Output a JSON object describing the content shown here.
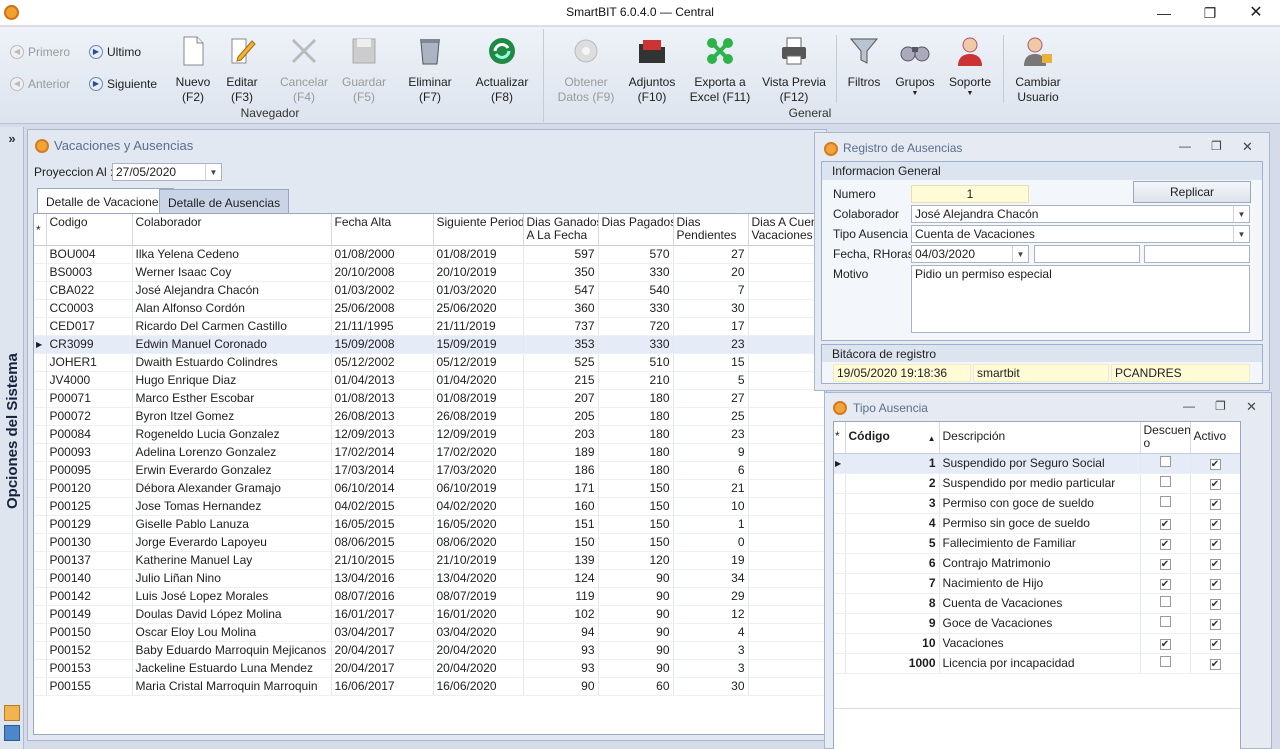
{
  "window": {
    "title": "SmartBIT 6.0.4.0 — Central",
    "minimize_icon": "minimize-icon",
    "maximize_icon": "restore-icon",
    "close_icon": "close-icon"
  },
  "navigator": {
    "first": "Primero",
    "last": "Ultimo",
    "previous": "Anterior",
    "next": "Siguiente",
    "group_label": "Navegador"
  },
  "toolbar": {
    "new": "Nuevo\n(F2)",
    "edit": "Editar\n(F3)",
    "cancel": "Cancelar\n(F4)",
    "save": "Guardar\n(F5)",
    "delete": "Eliminar\n(F7)",
    "refresh": "Actualizar\n(F8)",
    "get_data": "Obtener\nDatos (F9)",
    "attachments": "Adjuntos\n(F10)",
    "export_excel": "Exporta a\nExcel (F11)",
    "preview": "Vista Previa\n(F12)",
    "filters": "Filtros",
    "groups": "Grupos",
    "support": "Soporte",
    "change_user": "Cambiar\nUsuario",
    "general_label": "General"
  },
  "sidebar": {
    "label": "Opciones del Sistema",
    "expand": "»"
  },
  "vacations": {
    "title": "Vacaciones y Ausencias",
    "projection_label": "Proyeccion Al :",
    "projection_value": "27/05/2020",
    "tabs": [
      "Detalle de Vacaciones",
      "Detalle de Ausencias"
    ],
    "columns": [
      "Codigo",
      "Colaborador",
      "Fecha Alta",
      "Siguiente Periodo",
      "Dias Ganados\nA La Fecha",
      "Dias Pagados",
      "Dias\nPendientes",
      "Dias A Cuenta\nVacaciones"
    ],
    "rows": [
      [
        "BOU004",
        "Ilka Yelena Cedeno",
        "01/08/2000",
        "01/08/2019",
        "597",
        "570",
        "27",
        ""
      ],
      [
        "BS0003",
        "Werner Isaac Coy",
        "20/10/2008",
        "20/10/2019",
        "350",
        "330",
        "20",
        ""
      ],
      [
        "CBA022",
        "José Alejandra Chacón",
        "01/03/2002",
        "01/03/2020",
        "547",
        "540",
        "7",
        ""
      ],
      [
        "CC0003",
        "Alan Alfonso Cordón",
        "25/06/2008",
        "25/06/2020",
        "360",
        "330",
        "30",
        ""
      ],
      [
        "CED017",
        "Ricardo Del Carmen Castillo",
        "21/11/1995",
        "21/11/2019",
        "737",
        "720",
        "17",
        ""
      ],
      [
        "CR3099",
        "Edwin Manuel Coronado",
        "15/09/2008",
        "15/09/2019",
        "353",
        "330",
        "23",
        ""
      ],
      [
        "JOHER1",
        "Dwaith Estuardo Colindres",
        "05/12/2002",
        "05/12/2019",
        "525",
        "510",
        "15",
        ""
      ],
      [
        "JV4000",
        "Hugo Enrique Diaz",
        "01/04/2013",
        "01/04/2020",
        "215",
        "210",
        "5",
        ""
      ],
      [
        "P00071",
        "Marco Esther Escobar",
        "01/08/2013",
        "01/08/2019",
        "207",
        "180",
        "27",
        "3"
      ],
      [
        "P00072",
        "Byron Itzel Gomez",
        "26/08/2013",
        "26/08/2019",
        "205",
        "180",
        "25",
        "3"
      ],
      [
        "P00084",
        "Rogeneldo Lucia Gonzalez",
        "12/09/2013",
        "12/09/2019",
        "203",
        "180",
        "23",
        "3"
      ],
      [
        "P00093",
        "Adelina Lorenzo Gonzalez",
        "17/02/2014",
        "17/02/2020",
        "189",
        "180",
        "9",
        "3"
      ],
      [
        "P00095",
        "Erwin Everardo Gonzalez",
        "17/03/2014",
        "17/03/2020",
        "186",
        "180",
        "6",
        "0"
      ],
      [
        "P00120",
        "Débora Alexander Gramajo",
        "06/10/2014",
        "06/10/2019",
        "171",
        "150",
        "21",
        "3"
      ],
      [
        "P00125",
        "Jose Tomas Hernandez",
        "04/02/2015",
        "04/02/2020",
        "160",
        "150",
        "10",
        "3"
      ],
      [
        "P00129",
        "Giselle Pablo Lanuza",
        "16/05/2015",
        "16/05/2020",
        "151",
        "150",
        "1",
        "0"
      ],
      [
        "P00130",
        "Jorge Everardo Lapoyeu",
        "08/06/2015",
        "08/06/2020",
        "150",
        "150",
        "0",
        "0"
      ],
      [
        "P00137",
        "Katherine Manuel Lay",
        "21/10/2015",
        "21/10/2019",
        "139",
        "120",
        "19",
        "3"
      ],
      [
        "P00140",
        "Julio Liñan Nino",
        "13/04/2016",
        "13/04/2020",
        "124",
        "90",
        "34",
        "0"
      ],
      [
        "P00142",
        "Luis José Lopez Morales",
        "08/07/2016",
        "08/07/2019",
        "119",
        "90",
        "29",
        "3"
      ],
      [
        "P00149",
        "Doulas David López Molina",
        "16/01/2017",
        "16/01/2020",
        "102",
        "90",
        "12",
        "3"
      ],
      [
        "P00150",
        "Oscar Eloy Lou Molina",
        "03/04/2017",
        "03/04/2020",
        "94",
        "90",
        "4",
        "0"
      ],
      [
        "P00152",
        "Baby Eduardo Marroquin Mejicanos",
        "20/04/2017",
        "20/04/2020",
        "93",
        "90",
        "3",
        "0"
      ],
      [
        "P00153",
        "Jackeline Estuardo Luna Mendez",
        "20/04/2017",
        "20/04/2020",
        "93",
        "90",
        "3",
        "0"
      ],
      [
        "P00155",
        "Maria Cristal Marroquin Marroquin",
        "16/06/2017",
        "16/06/2020",
        "90",
        "60",
        "30",
        "0"
      ]
    ]
  },
  "registro": {
    "title": "Registro de Ausencias",
    "section_general": "Informacion General",
    "numero_label": "Numero",
    "numero_value": "1",
    "replicar": "Replicar",
    "colaborador_label": "Colaborador",
    "colaborador_value": "José Alejandra Chacón",
    "tipo_label": "Tipo Ausencia",
    "tipo_value": "Cuenta de Vacaciones",
    "fecha_label": "Fecha, RHoras",
    "fecha_value": "04/03/2020",
    "motivo_label": "Motivo",
    "motivo_value": "Pidio un permiso especial",
    "section_bitacora": "Bitácora de registro",
    "bitacora_fecha": "19/05/2020 19:18:36",
    "bitacora_usuario": "smartbit",
    "bitacora_equipo": "PCANDRES"
  },
  "tipo_ausencia": {
    "title": "Tipo Ausencia",
    "columns": [
      "Código",
      "Descripción",
      "Descuent\no",
      "Activo"
    ],
    "rows": [
      {
        "codigo": "1",
        "descripcion": "Suspendido por Seguro Social",
        "descuento": false,
        "activo": true
      },
      {
        "codigo": "2",
        "descripcion": "Suspendido por medio particular",
        "descuento": false,
        "activo": true
      },
      {
        "codigo": "3",
        "descripcion": "Permiso con goce de sueldo",
        "descuento": false,
        "activo": true
      },
      {
        "codigo": "4",
        "descripcion": "Permiso sin goce de sueldo",
        "descuento": true,
        "activo": true
      },
      {
        "codigo": "5",
        "descripcion": "Fallecimiento de Familiar",
        "descuento": true,
        "activo": true
      },
      {
        "codigo": "6",
        "descripcion": "Contrajo Matrimonio",
        "descuento": true,
        "activo": true
      },
      {
        "codigo": "7",
        "descripcion": "Nacimiento de Hijo",
        "descuento": true,
        "activo": true
      },
      {
        "codigo": "8",
        "descripcion": "Cuenta de Vacaciones",
        "descuento": false,
        "activo": true
      },
      {
        "codigo": "9",
        "descripcion": "Goce de Vacaciones",
        "descuento": false,
        "activo": true
      },
      {
        "codigo": "10",
        "descripcion": "Vacaciones",
        "descuento": true,
        "activo": true
      },
      {
        "codigo": "1000",
        "descripcion": "Licencia por incapacidad",
        "descuento": false,
        "activo": true
      }
    ]
  }
}
